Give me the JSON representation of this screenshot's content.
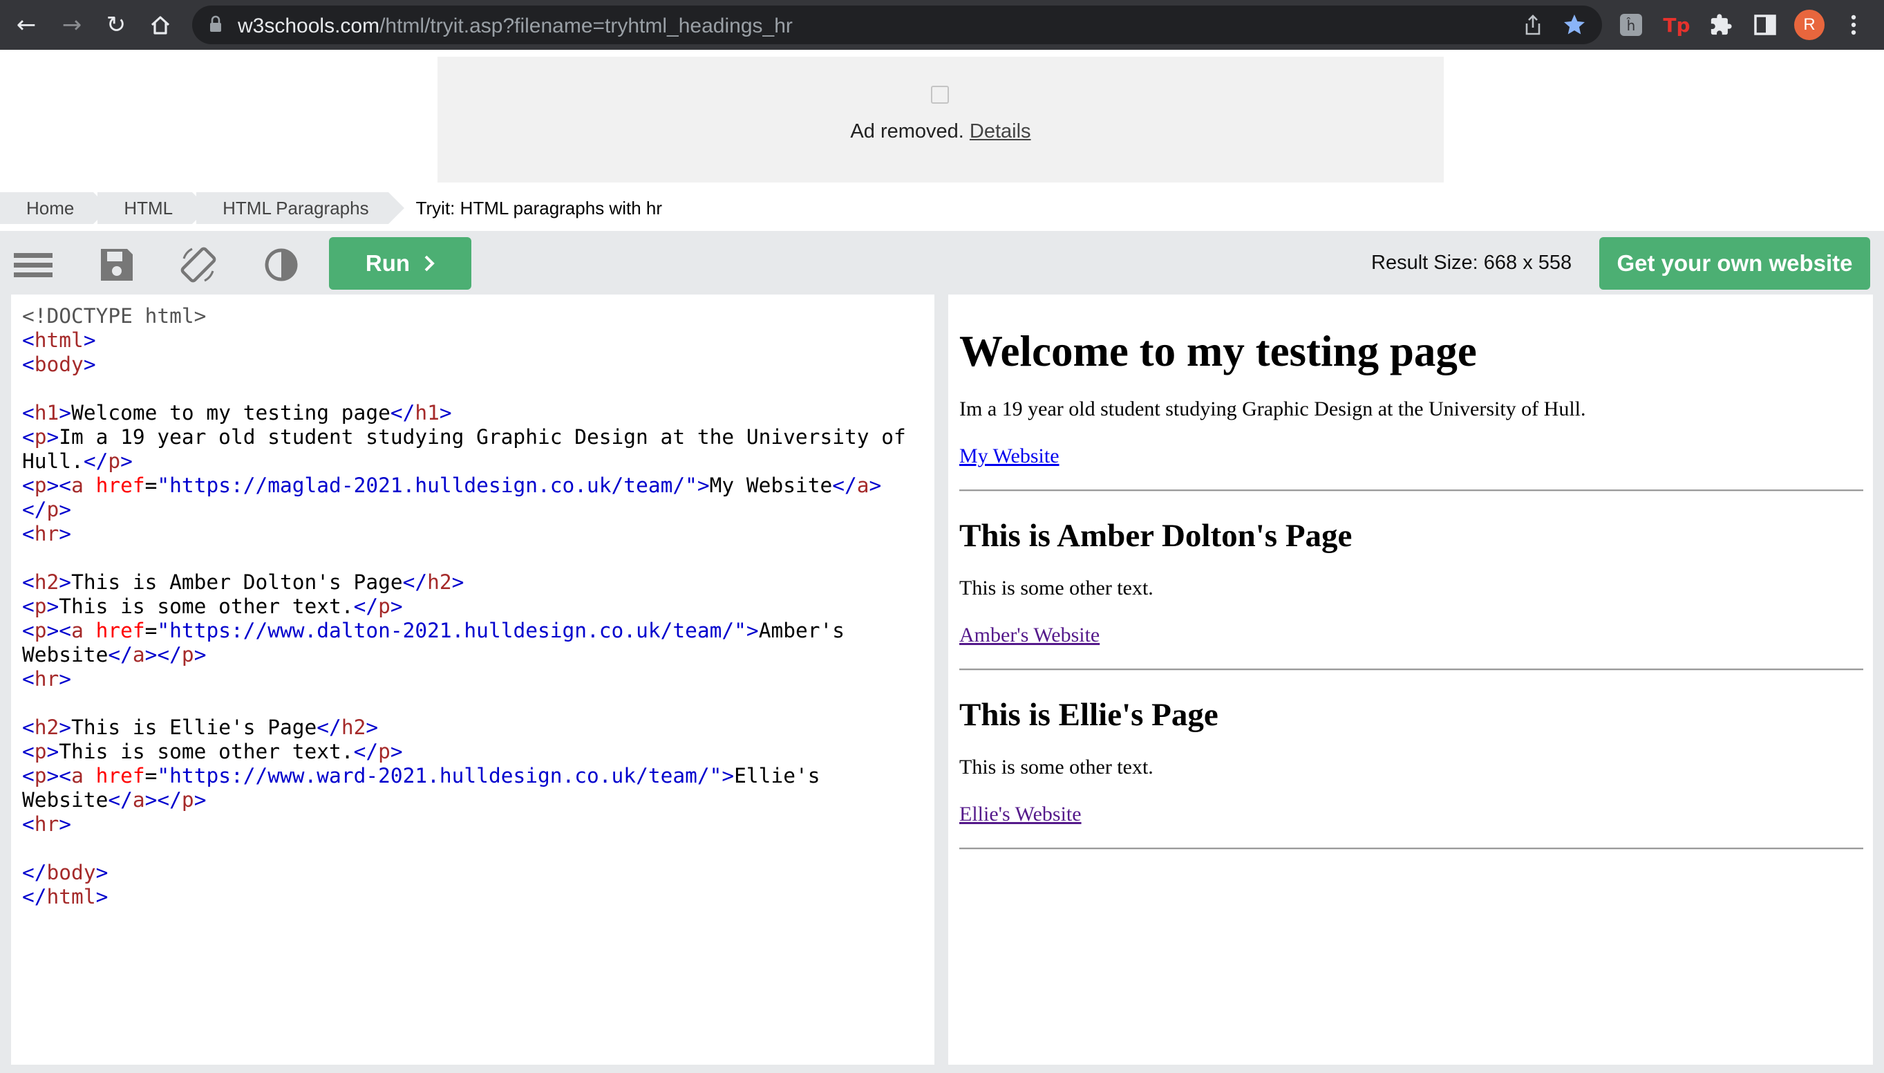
{
  "browser": {
    "url_domain": "w3schools.com",
    "url_path": "/html/tryit.asp?filename=tryhtml_headings_hr",
    "avatar_letter": "R",
    "ext_tp_label": "Tp"
  },
  "ad": {
    "text": "Ad removed.",
    "details_link": "Details"
  },
  "breadcrumb": [
    "Home",
    "HTML",
    "HTML Paragraphs",
    "Tryit: HTML paragraphs with hr"
  ],
  "toolbar": {
    "run_label": "Run",
    "result_size": "Result Size: 668 x 558",
    "get_website_label": "Get your own website"
  },
  "code_lines": [
    [
      [
        "dt",
        "<!DOCTYPE html>"
      ]
    ],
    [
      [
        "br",
        "<"
      ],
      [
        "tag",
        "html"
      ],
      [
        "br",
        ">"
      ]
    ],
    [
      [
        "br",
        "<"
      ],
      [
        "tag",
        "body"
      ],
      [
        "br",
        ">"
      ]
    ],
    [],
    [
      [
        "br",
        "<"
      ],
      [
        "tag",
        "h1"
      ],
      [
        "br",
        ">"
      ],
      [
        "txt",
        "Welcome to my testing page"
      ],
      [
        "br",
        "</"
      ],
      [
        "tag",
        "h1"
      ],
      [
        "br",
        ">"
      ]
    ],
    [
      [
        "br",
        "<"
      ],
      [
        "tag",
        "p"
      ],
      [
        "br",
        ">"
      ],
      [
        "txt",
        "Im a 19 year old student studying Graphic Design at the University of"
      ]
    ],
    [
      [
        "txt",
        "Hull."
      ],
      [
        "br",
        "</"
      ],
      [
        "tag",
        "p"
      ],
      [
        "br",
        ">"
      ]
    ],
    [
      [
        "br",
        "<"
      ],
      [
        "tag",
        "p"
      ],
      [
        "br",
        "><"
      ],
      [
        "tag",
        "a"
      ],
      [
        "txt",
        " "
      ],
      [
        "attr",
        "href"
      ],
      [
        "txt",
        "="
      ],
      [
        "val",
        "\"https://maglad-2021.hulldesign.co.uk/team/\""
      ],
      [
        "br",
        ">"
      ],
      [
        "txt",
        "My Website"
      ],
      [
        "br",
        "</"
      ],
      [
        "tag",
        "a"
      ],
      [
        "br",
        ">"
      ]
    ],
    [
      [
        "br",
        "</"
      ],
      [
        "tag",
        "p"
      ],
      [
        "br",
        ">"
      ]
    ],
    [
      [
        "br",
        "<"
      ],
      [
        "tag",
        "hr"
      ],
      [
        "br",
        ">"
      ]
    ],
    [],
    [
      [
        "br",
        "<"
      ],
      [
        "tag",
        "h2"
      ],
      [
        "br",
        ">"
      ],
      [
        "txt",
        "This is Amber Dolton's Page"
      ],
      [
        "br",
        "</"
      ],
      [
        "tag",
        "h2"
      ],
      [
        "br",
        ">"
      ]
    ],
    [
      [
        "br",
        "<"
      ],
      [
        "tag",
        "p"
      ],
      [
        "br",
        ">"
      ],
      [
        "txt",
        "This is some other text."
      ],
      [
        "br",
        "</"
      ],
      [
        "tag",
        "p"
      ],
      [
        "br",
        ">"
      ]
    ],
    [
      [
        "br",
        "<"
      ],
      [
        "tag",
        "p"
      ],
      [
        "br",
        "><"
      ],
      [
        "tag",
        "a"
      ],
      [
        "txt",
        " "
      ],
      [
        "attr",
        "href"
      ],
      [
        "txt",
        "="
      ],
      [
        "val",
        "\"https://www.dalton-2021.hulldesign.co.uk/team/\""
      ],
      [
        "br",
        ">"
      ],
      [
        "txt",
        "Amber's"
      ]
    ],
    [
      [
        "txt",
        "Website"
      ],
      [
        "br",
        "</"
      ],
      [
        "tag",
        "a"
      ],
      [
        "br",
        "></"
      ],
      [
        "tag",
        "p"
      ],
      [
        "br",
        ">"
      ]
    ],
    [
      [
        "br",
        "<"
      ],
      [
        "tag",
        "hr"
      ],
      [
        "br",
        ">"
      ]
    ],
    [],
    [
      [
        "br",
        "<"
      ],
      [
        "tag",
        "h2"
      ],
      [
        "br",
        ">"
      ],
      [
        "txt",
        "This is Ellie's Page"
      ],
      [
        "br",
        "</"
      ],
      [
        "tag",
        "h2"
      ],
      [
        "br",
        ">"
      ]
    ],
    [
      [
        "br",
        "<"
      ],
      [
        "tag",
        "p"
      ],
      [
        "br",
        ">"
      ],
      [
        "txt",
        "This is some other text."
      ],
      [
        "br",
        "</"
      ],
      [
        "tag",
        "p"
      ],
      [
        "br",
        ">"
      ]
    ],
    [
      [
        "br",
        "<"
      ],
      [
        "tag",
        "p"
      ],
      [
        "br",
        "><"
      ],
      [
        "tag",
        "a"
      ],
      [
        "txt",
        " "
      ],
      [
        "attr",
        "href"
      ],
      [
        "txt",
        "="
      ],
      [
        "val",
        "\"https://www.ward-2021.hulldesign.co.uk/team/\""
      ],
      [
        "br",
        ">"
      ],
      [
        "txt",
        "Ellie's"
      ]
    ],
    [
      [
        "txt",
        "Website"
      ],
      [
        "br",
        "</"
      ],
      [
        "tag",
        "a"
      ],
      [
        "br",
        "></"
      ],
      [
        "tag",
        "p"
      ],
      [
        "br",
        ">"
      ]
    ],
    [
      [
        "br",
        "<"
      ],
      [
        "tag",
        "hr"
      ],
      [
        "br",
        ">"
      ]
    ],
    [],
    [
      [
        "br",
        "</"
      ],
      [
        "tag",
        "body"
      ],
      [
        "br",
        ">"
      ]
    ],
    [
      [
        "br",
        "</"
      ],
      [
        "tag",
        "html"
      ],
      [
        "br",
        ">"
      ]
    ]
  ],
  "result": {
    "h1": "Welcome to my testing page",
    "intro": "Im a 19 year old student studying Graphic Design at the University of Hull.",
    "link1": "My Website",
    "section2_title": "This is Amber Dolton's Page",
    "section2_text": "This is some other text.",
    "link2": "Amber's Website",
    "section3_title": "This is Ellie's Page",
    "section3_text": "This is some other text.",
    "link3": "Ellie's Website"
  }
}
